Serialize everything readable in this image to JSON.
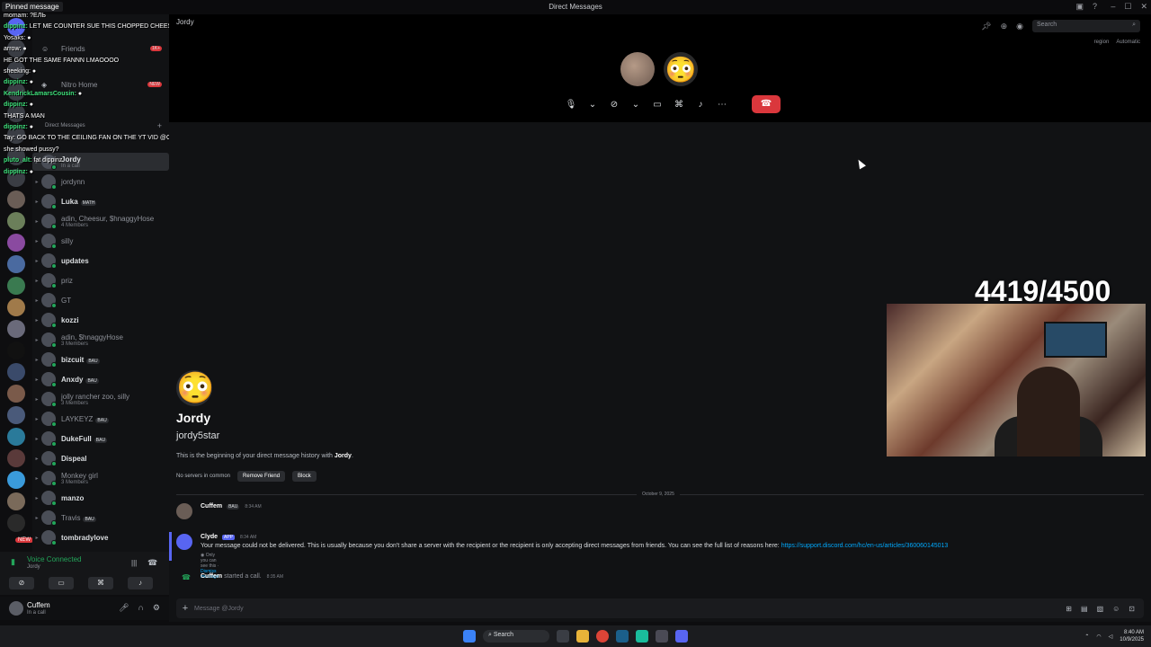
{
  "window": {
    "title": "Direct Messages"
  },
  "header": {
    "call_name": "Jordy",
    "search_placeholder": "Search",
    "region_label": "region",
    "region_value": "Automatic"
  },
  "chat_overlay": {
    "pinned": "Pinned message",
    "lines": [
      {
        "user": "",
        "text": "momam: ?ЕЛЬ"
      },
      {
        "user": "dippinz:",
        "text": "LET ME COUNTER SUE THIS CHOPPED CHEESE IM TRUMATIZED"
      },
      {
        "user": "",
        "text": "Yosaks: ●"
      },
      {
        "user": "",
        "text": "arrow: ●"
      },
      {
        "user": "",
        "text": "HE GOT THE SAME FANNN LMAOOOO"
      },
      {
        "user": "",
        "text": "sheeking: ●"
      },
      {
        "user": "dippinz:",
        "text": "●"
      },
      {
        "user": "KendrickLamarsCousin:",
        "text": "●"
      },
      {
        "user": "dippinz:",
        "text": "●"
      },
      {
        "user": "",
        "text": "THATS A MAN"
      },
      {
        "user": "dippinz:",
        "text": "●"
      },
      {
        "user": "",
        "text": "Tay: GO BACK TO THE CEILING FAN ON THE YT VID @CUFFEM"
      },
      {
        "user": "",
        "text": "she showed pussy?"
      },
      {
        "user": "pluto_alt:",
        "text": "fat dippinz"
      },
      {
        "user": "dippinz:",
        "text": "●"
      }
    ]
  },
  "sidebar": {
    "friends": "Friends",
    "friends_badge": "1K+",
    "nitro": "Nitro Home",
    "nitro_badge": "NEW",
    "dm_header": "Direct Messages",
    "items": [
      {
        "name": "Jordy",
        "sub": "In a call",
        "selected": true
      },
      {
        "name": "jordynn",
        "sub": "",
        "dim": true
      },
      {
        "name": "Luka",
        "sub": "",
        "tag": "MATH"
      },
      {
        "name": "adin, Cheesur, $hnaggyHose",
        "sub": "4 Members",
        "dim": true
      },
      {
        "name": "silly",
        "sub": "",
        "dim": true
      },
      {
        "name": "updates",
        "sub": ""
      },
      {
        "name": "priz",
        "sub": "",
        "dim": true
      },
      {
        "name": "GT",
        "sub": "",
        "dim": true
      },
      {
        "name": "kozzi",
        "sub": ""
      },
      {
        "name": "adin, $hnaggyHose",
        "sub": "3 Members",
        "dim": true
      },
      {
        "name": "bizcuit",
        "sub": "",
        "tag": "BAU"
      },
      {
        "name": "Anxdy",
        "sub": "",
        "tag": "BAU"
      },
      {
        "name": "jolly rancher zoo, silly",
        "sub": "3 Members",
        "dim": true
      },
      {
        "name": "LAYKEYZ",
        "sub": "",
        "tag": "BAU",
        "dim": true
      },
      {
        "name": "DukeFull",
        "sub": "",
        "tag": "BAU"
      },
      {
        "name": "Dispeal",
        "sub": ""
      },
      {
        "name": "Monkey girl",
        "sub": "3 Members",
        "dim": true
      },
      {
        "name": "manzo",
        "sub": ""
      },
      {
        "name": "Travis",
        "sub": "",
        "tag": "BAU",
        "dim": true
      },
      {
        "name": "tombradylove",
        "sub": ""
      }
    ]
  },
  "voice": {
    "status": "Voice Connected",
    "channel": "Jordy"
  },
  "user": {
    "name": "Cuffem",
    "status": "In a call"
  },
  "profile": {
    "display_name": "Jordy",
    "username": "jordy5star",
    "intro_prefix": "This is the beginning of your direct message history with ",
    "intro_name": "Jordy",
    "intro_suffix": ".",
    "servers": "No servers in common",
    "remove_friend": "Remove Friend",
    "block": "Block"
  },
  "date_divider": "October 9, 2025",
  "messages": [
    {
      "author": "Cuffem",
      "tag": "BAU",
      "time": "8:34 AM",
      "text": ""
    },
    {
      "author": "Clyde",
      "app_tag": "APP",
      "time": "8:34 AM",
      "text": "Your message could not be delivered. This is usually because you don't share a server with the recipient or the recipient is only accepting direct messages from friends. You can see the full list of reasons here: ",
      "link": "https://support.discord.com/hc/en-us/articles/360060145013",
      "note": "Only you can see this · ",
      "dismiss": "Dismiss message"
    },
    {
      "author": "Cuffem",
      "text": "started a call.",
      "time": "8:35 AM"
    }
  ],
  "composer": {
    "placeholder": "Message @Jordy"
  },
  "stream": {
    "counter": "4419/4500"
  },
  "taskbar": {
    "search": "Search",
    "time": "8:40 AM",
    "date": "10/9/2025"
  },
  "colors": {
    "accent": "#5865f2",
    "online": "#23a55a",
    "danger": "#da373c",
    "link": "#00a8fc"
  }
}
